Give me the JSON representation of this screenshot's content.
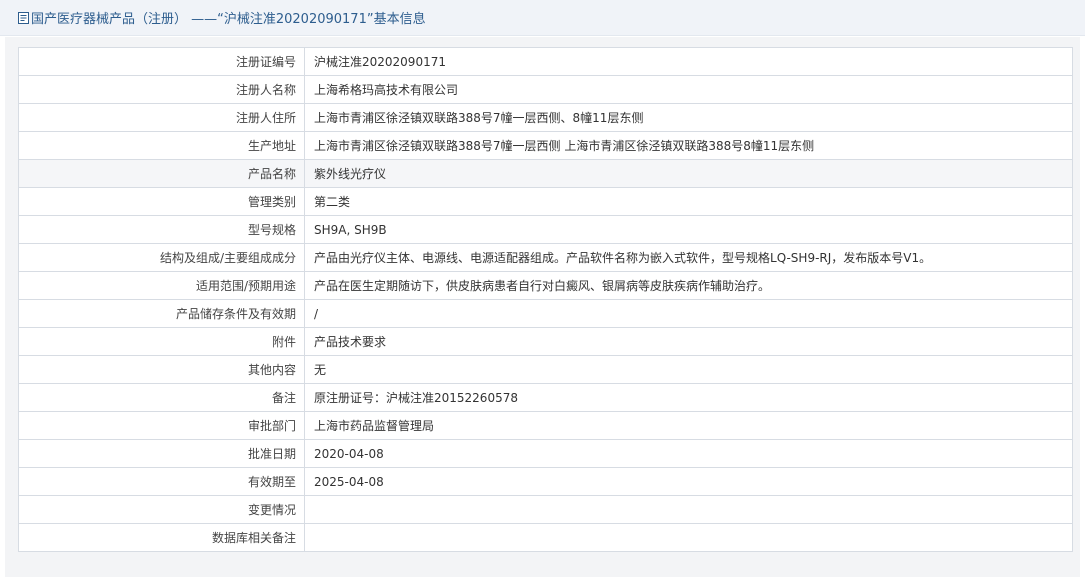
{
  "header": {
    "title": "国产医疗器械产品（注册） ——“沪械注准20202090171”基本信息"
  },
  "rows": [
    {
      "label": "注册证编号",
      "value": "沪械注准20202090171"
    },
    {
      "label": "注册人名称",
      "value": "上海希格玛高技术有限公司"
    },
    {
      "label": "注册人住所",
      "value": "上海市青浦区徐泾镇双联路388号7幢一层西侧、8幢11层东侧"
    },
    {
      "label": "生产地址",
      "value": "上海市青浦区徐泾镇双联路388号7幢一层西侧 上海市青浦区徐泾镇双联路388号8幢11层东侧"
    },
    {
      "label": "产品名称",
      "value": "紫外线光疗仪"
    },
    {
      "label": "管理类别",
      "value": "第二类"
    },
    {
      "label": "型号规格",
      "value": "SH9A, SH9B"
    },
    {
      "label": "结构及组成/主要组成成分",
      "value": "产品由光疗仪主体、电源线、电源适配器组成。产品软件名称为嵌入式软件，型号规格LQ-SH9-RJ，发布版本号V1。"
    },
    {
      "label": "适用范围/预期用途",
      "value": "产品在医生定期随访下，供皮肤病患者自行对白癜风、银屑病等皮肤疾病作辅助治疗。"
    },
    {
      "label": "产品储存条件及有效期",
      "value": "/"
    },
    {
      "label": "附件",
      "value": "产品技术要求"
    },
    {
      "label": "其他内容",
      "value": "无"
    },
    {
      "label": "备注",
      "value": "原注册证号：沪械注准20152260578"
    },
    {
      "label": "审批部门",
      "value": "上海市药品监督管理局"
    },
    {
      "label": "批准日期",
      "value": "2020-04-08"
    },
    {
      "label": "有效期至",
      "value": "2025-04-08"
    },
    {
      "label": "变更情况",
      "value": ""
    },
    {
      "label": "数据库相关备注",
      "value": ""
    }
  ]
}
